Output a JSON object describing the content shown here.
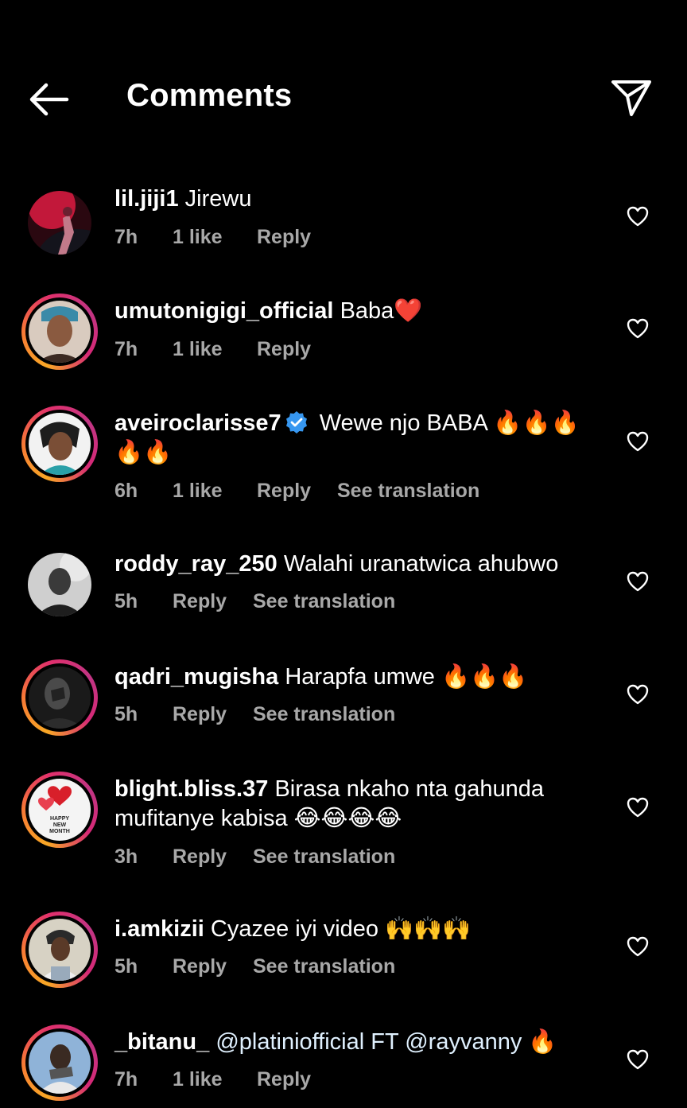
{
  "header": {
    "title": "Comments"
  },
  "labels": {
    "reply": "Reply",
    "see_translation": "See translation"
  },
  "comments": [
    {
      "username": "lil.jiji1",
      "text": "Jirewu",
      "time": "7h",
      "likes": "1 like"
    },
    {
      "username": "umutonigigi_official",
      "text": "Baba❤️",
      "time": "7h",
      "likes": "1 like"
    },
    {
      "username": "aveiroclarisse7",
      "verified": true,
      "text": "Wewe njo BABA 🔥🔥🔥🔥🔥",
      "time": "6h",
      "likes": "1 like"
    },
    {
      "username": "roddy_ray_250",
      "text": "Walahi uranatwica ahubwo",
      "time": "5h"
    },
    {
      "username": "qadri_mugisha",
      "text": "Harapfa umwe 🔥🔥🔥",
      "time": "5h"
    },
    {
      "username": "blight.bliss.37",
      "text": "Birasa nkaho nta gahunda mufitanye kabisa 😂😂😂😂",
      "time": "3h",
      "avatar_text": "HAPPY NEW MONTH"
    },
    {
      "username": "i.amkizii",
      "text": "Cyazee iyi video 🙌🙌🙌",
      "time": "5h"
    },
    {
      "username": "_bitanu_",
      "text": "@platiniofficial  FT @rayvanny 🔥",
      "time": "7h",
      "likes": "1 like"
    }
  ],
  "colors": {
    "background": "#000000",
    "meta": "#a8a8a8",
    "verified": "#3797f0"
  }
}
